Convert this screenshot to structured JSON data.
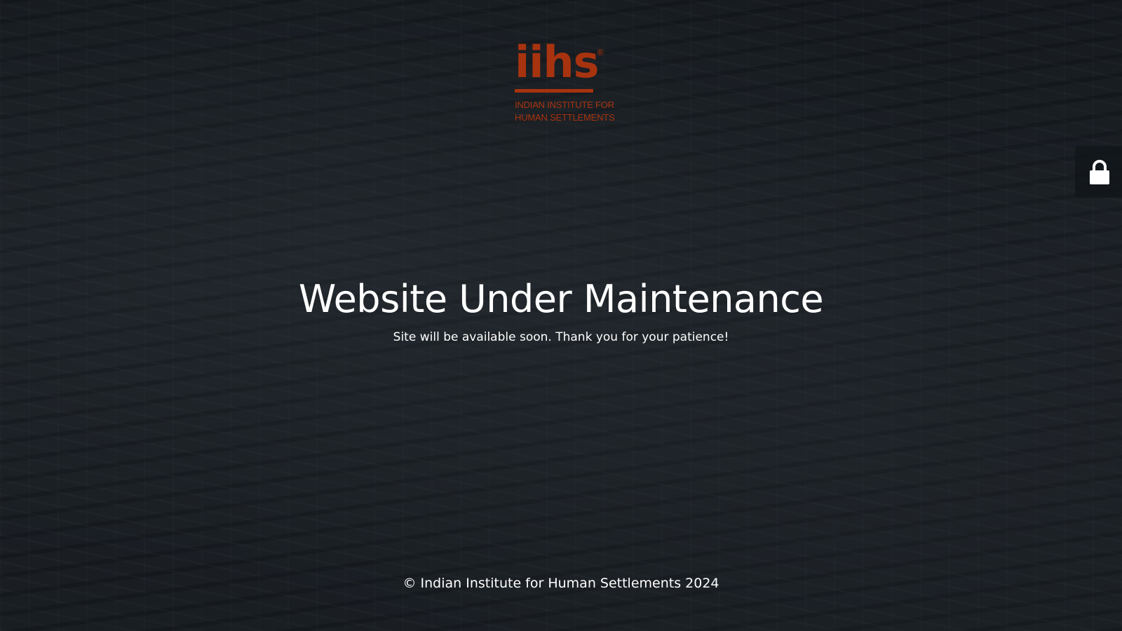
{
  "logo": {
    "mark": "iihs",
    "registered": "®",
    "line1": "INDIAN INSTITUTE FOR",
    "line2": "HUMAN SETTLEMENTS",
    "brand_color": "#a8330f"
  },
  "main": {
    "headline": "Website Under Maintenance",
    "subtext": "Site will be available soon. Thank you for your patience!"
  },
  "footer": {
    "copyright": "© Indian Institute for Human Settlements 2024"
  },
  "login": {
    "icon": "lock-icon"
  },
  "colors": {
    "text": "#ffffff",
    "background": "#1c2127",
    "brand": "#a8330f"
  }
}
